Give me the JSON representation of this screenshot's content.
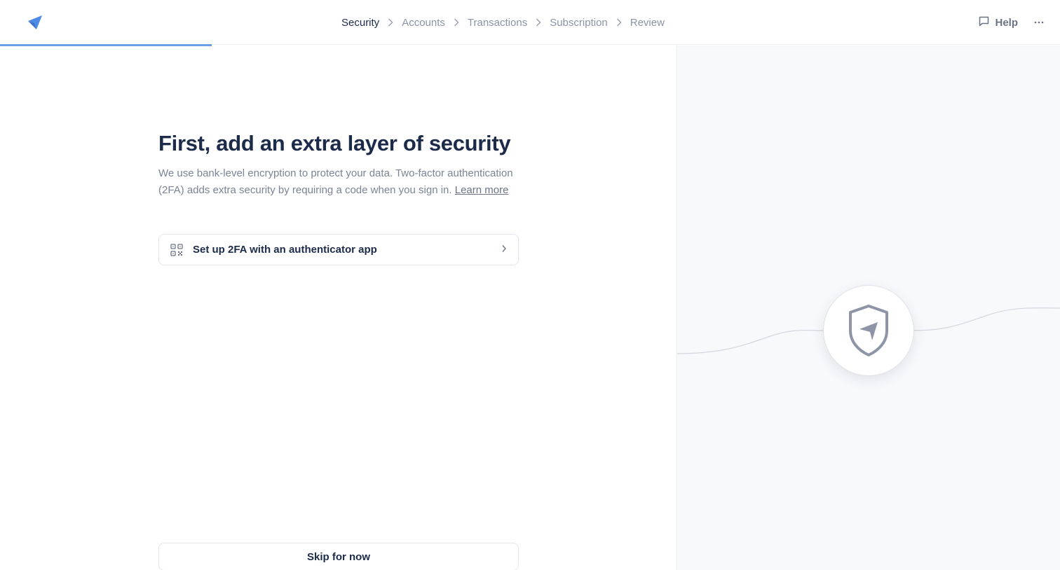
{
  "header": {
    "logo_icon": "paper-plane-icon",
    "steps": [
      {
        "label": "Security",
        "active": true
      },
      {
        "label": "Accounts",
        "active": false
      },
      {
        "label": "Transactions",
        "active": false
      },
      {
        "label": "Subscription",
        "active": false
      },
      {
        "label": "Review",
        "active": false
      }
    ],
    "help_label": "Help",
    "help_icon": "chat-bubble-icon",
    "more_icon": "ellipsis-icon",
    "progress_percent": 20
  },
  "main": {
    "title": "First, add an extra layer of security",
    "description": "We use bank-level encryption to protect your data. Two-factor authentication (2FA) adds extra security by requiring a code when you sign in.",
    "learn_more": "Learn more",
    "option_label": "Set up 2FA with an authenticator app",
    "option_icon": "qr-code-icon",
    "skip_label": "Skip for now"
  },
  "illustration": {
    "icon": "shield-plane-icon"
  },
  "colors": {
    "accent": "#6d9ee8",
    "text_primary": "#1c2b4a",
    "text_muted": "#8b93a5",
    "panel_bg": "#f8f9fb"
  }
}
